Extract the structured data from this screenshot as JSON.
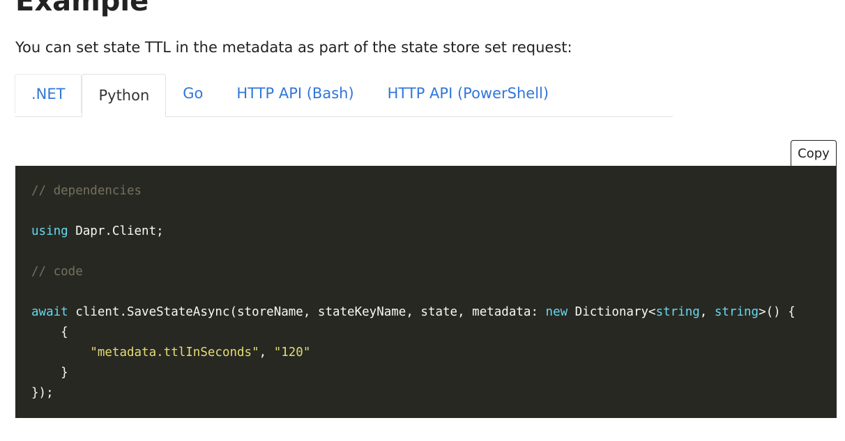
{
  "heading": "Example",
  "intro": "You can set state TTL in the metadata as part of the state store set request:",
  "tabs": [
    {
      "label": ".NET"
    },
    {
      "label": "Python"
    },
    {
      "label": "Go"
    },
    {
      "label": "HTTP API (Bash)"
    },
    {
      "label": "HTTP API (PowerShell)"
    }
  ],
  "active_tab": "Python",
  "copy_button": "Copy",
  "code": {
    "comment_dependencies": "// dependencies",
    "using_kw": "using",
    "using_rest": " Dapr.Client;",
    "comment_code": "// code",
    "await_kw": "await",
    "call_start": " client.SaveStateAsync(storeName, stateKeyName, state, metadata: ",
    "new_kw": "new",
    "dict_name": " Dictionary<",
    "string_kw_1": "string",
    "comma_sep": ", ",
    "string_kw_2": "string",
    "call_end": ">() {",
    "open_brace": "    {",
    "indent": "        ",
    "str_key": "\"metadata.ttlInSeconds\"",
    "pair_sep": ", ",
    "str_val": "\"120\"",
    "close_brace": "    }",
    "closing": "});"
  }
}
